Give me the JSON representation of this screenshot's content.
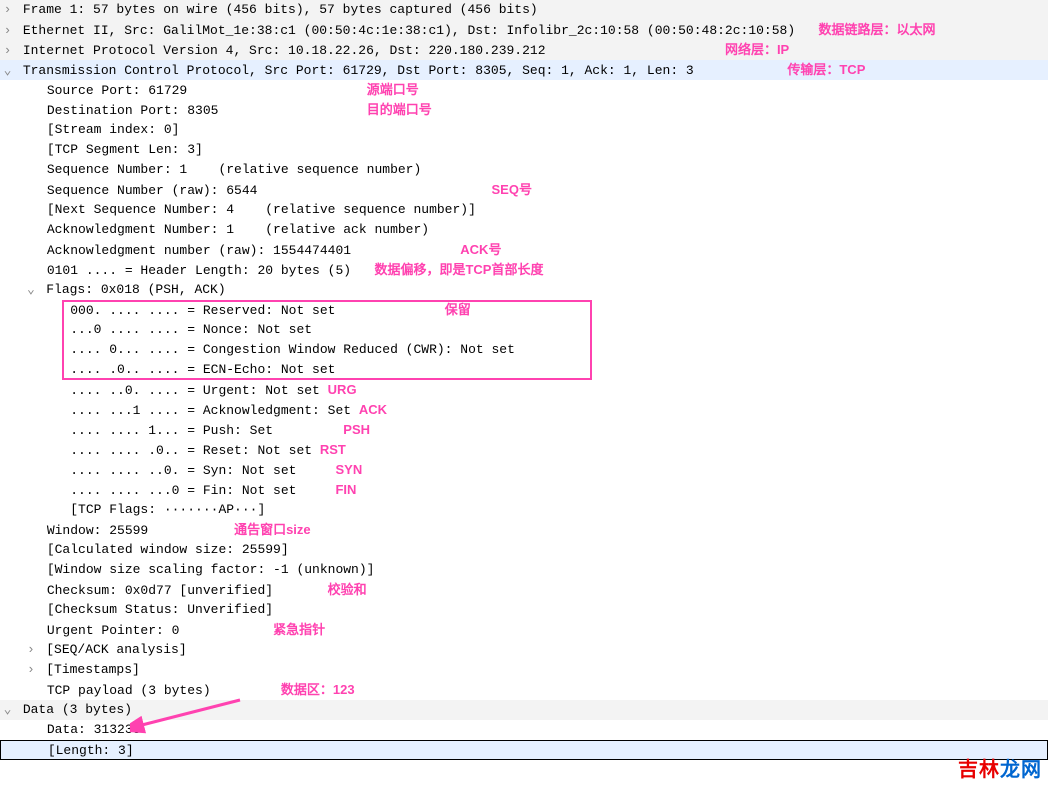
{
  "tree": {
    "frame": "Frame 1: 57 bytes on wire (456 bits), 57 bytes captured (456 bits)",
    "eth": "Ethernet II, Src: GalilMot_1e:38:c1 (00:50:4c:1e:38:c1), Dst: Infolibr_2c:10:58 (00:50:48:2c:10:58)",
    "ip": "Internet Protocol Version 4, Src: 10.18.22.26, Dst: 220.180.239.212",
    "tcp": "Transmission Control Protocol, Src Port: 61729, Dst Port: 8305, Seq: 1, Ack: 1, Len: 3",
    "src_port": "Source Port: 61729",
    "dst_port": "Destination Port: 8305",
    "stream": "[Stream index: 0]",
    "seglen": "[TCP Segment Len: 3]",
    "seqrel": "Sequence Number: 1    (relative sequence number)",
    "seqraw": "Sequence Number (raw): 6544",
    "nseq": "[Next Sequence Number: 4    (relative sequence number)]",
    "ackrel": "Acknowledgment Number: 1    (relative ack number)",
    "ackraw": "Acknowledgment number (raw): 1554474401",
    "hdrlen": "0101 .... = Header Length: 20 bytes (5)",
    "flags": "Flags: 0x018 (PSH, ACK)",
    "f_res": "000. .... .... = Reserved: Not set",
    "f_nonce": "...0 .... .... = Nonce: Not set",
    "f_cwr": ".... 0... .... = Congestion Window Reduced (CWR): Not set",
    "f_ecn": ".... .0.. .... = ECN-Echo: Not set",
    "f_urg": ".... ..0. .... = Urgent: Not set",
    "f_ack": ".... ...1 .... = Acknowledgment: Set",
    "f_psh": ".... .... 1... = Push: Set",
    "f_rst": ".... .... .0.. = Reset: Not set",
    "f_syn": ".... .... ..0. = Syn: Not set",
    "f_fin": ".... .... ...0 = Fin: Not set",
    "tcpflags": "[TCP Flags: ·······AP···]",
    "window": "Window: 25599",
    "calcwin": "[Calculated window size: 25599]",
    "winscale": "[Window size scaling factor: -1 (unknown)]",
    "checksum": "Checksum: 0x0d77 [unverified]",
    "ckstatus": "[Checksum Status: Unverified]",
    "urgptr": "Urgent Pointer: 0",
    "seqack": "[SEQ/ACK analysis]",
    "ts": "[Timestamps]",
    "payload": "TCP payload (3 bytes)",
    "data_hdr": "Data (3 bytes)",
    "data_val": "Data: 313233",
    "data_len": "[Length: 3]"
  },
  "notes": {
    "eth": "数据链路层：以太网",
    "ip": "网络层：IP",
    "tcp": "传输层：TCP",
    "src": "源端口号",
    "dst": "目的端口号",
    "seq": "SEQ号",
    "ack": "ACK号",
    "hdr": "数据偏移，即是TCP首部长度",
    "reserved": "保留",
    "urg": "URG",
    "ackf": "ACK",
    "psh": "PSH",
    "rst": "RST",
    "syn": "SYN",
    "fin": "FIN",
    "win": "通告窗口size",
    "chk": "校验和",
    "urgp": "紧急指针",
    "dataz": "数据区：123"
  },
  "watermark": {
    "left": "吉林",
    "right": "龙网"
  }
}
